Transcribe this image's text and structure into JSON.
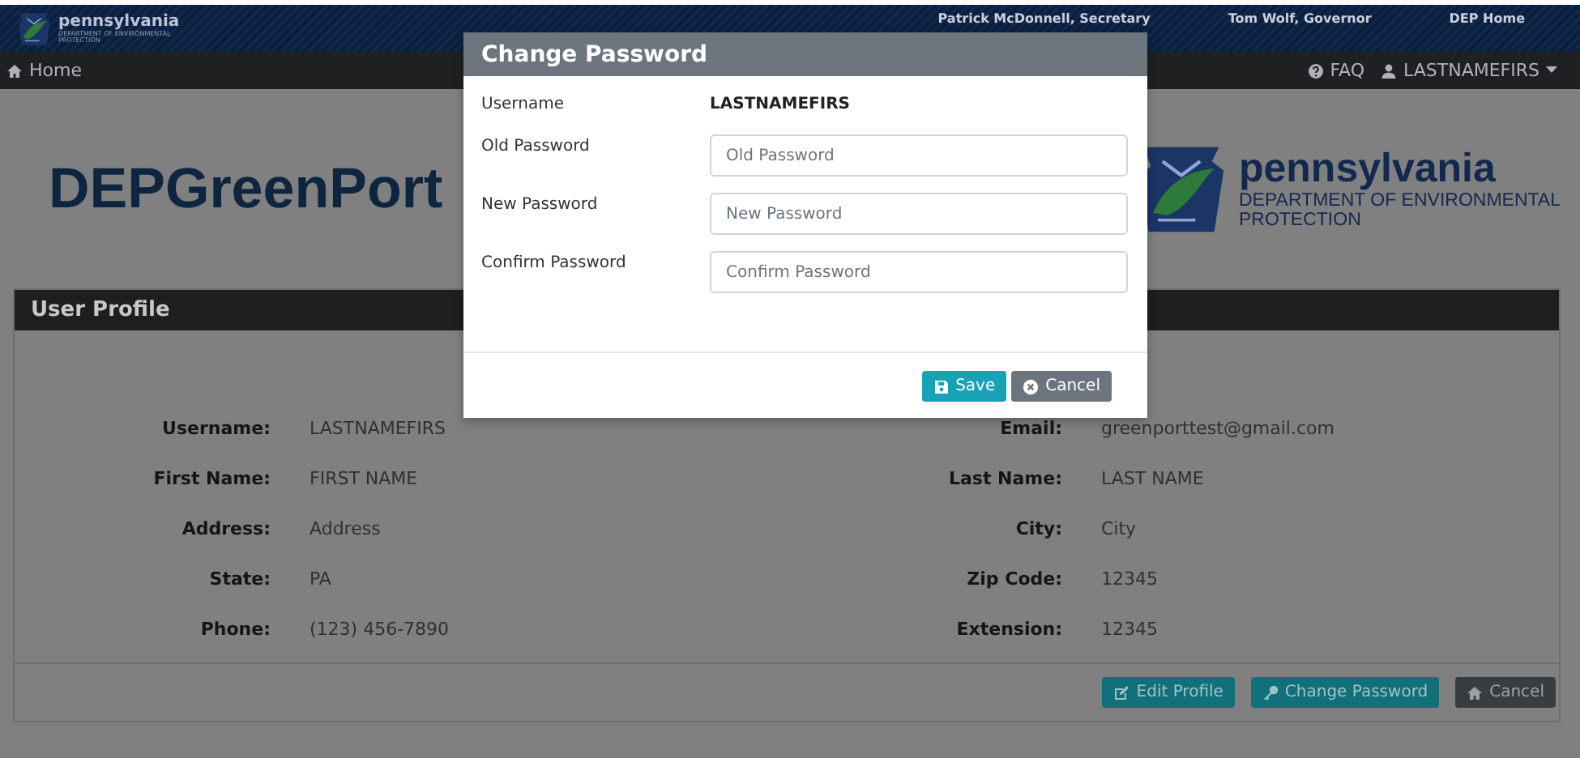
{
  "banner": {
    "logo_title": "pennsylvania",
    "logo_subtitle_1": "DEPARTMENT OF ENVIRONMENTAL",
    "logo_subtitle_2": "PROTECTION",
    "links": [
      "Patrick McDonnell, Secretary",
      "Tom Wolf, Governor",
      "DEP Home"
    ]
  },
  "navbar": {
    "home": "Home",
    "faq": "FAQ",
    "user": "LASTNAMEFIRS"
  },
  "header": {
    "title": "DEPGreenPort",
    "logo_title": "pennsylvania",
    "logo_subtitle_1": "DEPARTMENT OF ENVIRONMENTAL",
    "logo_subtitle_2": "PROTECTION"
  },
  "profile": {
    "title": "User Profile",
    "rows": [
      {
        "left_label": "Username:",
        "left_value": "LASTNAMEFIRS",
        "right_label": "Email:",
        "right_value": "greenporttest@gmail.com"
      },
      {
        "left_label": "First Name:",
        "left_value": "FIRST NAME",
        "right_label": "Last Name:",
        "right_value": "LAST NAME"
      },
      {
        "left_label": "Address:",
        "left_value": "Address",
        "right_label": "City:",
        "right_value": "City"
      },
      {
        "left_label": "State:",
        "left_value": "PA",
        "right_label": "Zip Code:",
        "right_value": "12345"
      },
      {
        "left_label": "Phone:",
        "left_value": "(123) 456-7890",
        "right_label": "Extension:",
        "right_value": "12345"
      }
    ],
    "buttons": [
      {
        "label": "Edit Profile",
        "kind": "edit"
      },
      {
        "label": "Change Password",
        "kind": "key"
      },
      {
        "label": "Cancel",
        "kind": "home"
      }
    ]
  },
  "dialog": {
    "title": "Change Password",
    "username_label": "Username",
    "username_value": "LASTNAMEFIRS",
    "fields": [
      {
        "label": "Old Password",
        "placeholder": "Old Password"
      },
      {
        "label": "New Password",
        "placeholder": "New Password"
      },
      {
        "label": "Confirm Password",
        "placeholder": "Confirm Password"
      }
    ],
    "buttons": [
      {
        "label": "Save",
        "kind": "save"
      },
      {
        "label": "Cancel",
        "kind": "cancel"
      }
    ]
  }
}
